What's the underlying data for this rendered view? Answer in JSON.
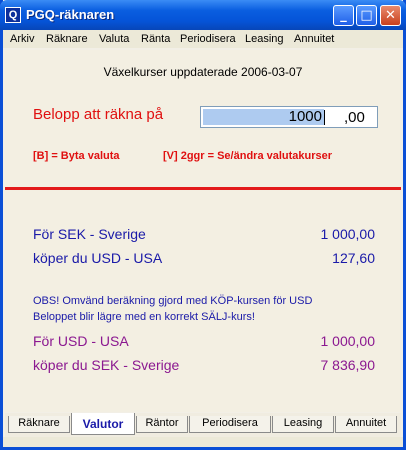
{
  "window": {
    "title": "PGQ-räknaren"
  },
  "titlebar": {
    "minimize": "_",
    "maximize": "□",
    "close": "✕"
  },
  "menu": [
    "Arkiv",
    "Räknare",
    "Valuta",
    "Ränta",
    "Periodisera",
    "Leasing",
    "Annuitet"
  ],
  "header": {
    "updated": "Växelkurser uppdaterade 2006-03-07"
  },
  "amount": {
    "label": "Belopp att räkna på",
    "integer": "1000",
    "decimals": ",00"
  },
  "hints": {
    "change_currency": "[B] = Byta valuta",
    "edit_rates": "[V] 2ggr = Se/ändra valutakurser"
  },
  "result": {
    "from_label": "För  SEK - Sverige",
    "from_value": "1 000,00",
    "to_label": "köper du USD - USA",
    "to_value": "127,60"
  },
  "notice": {
    "line1": "OBS! Omvänd beräkning gjord med KÖP-kursen för USD",
    "line2": "Beloppet blir lägre med en korrekt SÄLJ-kurs!"
  },
  "reverse": {
    "from_label": "För  USD - USA",
    "from_value": "1 000,00",
    "to_label": "köper du SEK - Sverige",
    "to_value": "7 836,90"
  },
  "tabs": [
    "Räknare",
    "Valutor",
    "Räntor",
    "Periodisera",
    "Leasing",
    "Annuitet"
  ],
  "active_tab": "Valutor",
  "colors": {
    "accent_red": "#e01010",
    "info_blue": "#1a1aa8",
    "reverse_purple": "#8b1890",
    "titlebar_blue": "#0554d8"
  }
}
